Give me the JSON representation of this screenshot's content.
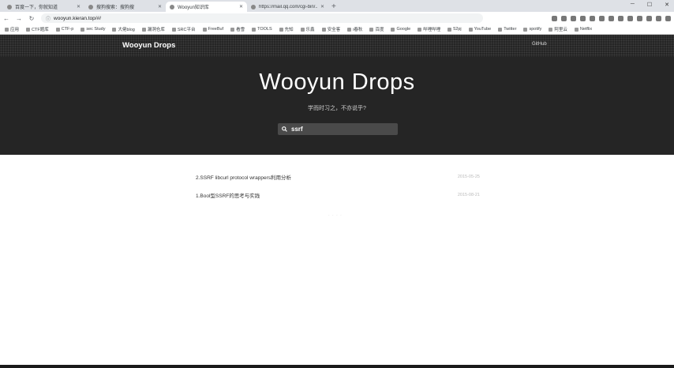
{
  "browser": {
    "tabs": [
      {
        "title": "百度一下，你就知道",
        "active": false
      },
      {
        "title": "搜狗搜索：搜狗搜",
        "active": false
      },
      {
        "title": "Wooyun知识库",
        "active": true
      },
      {
        "title": "https://mail.qq.com/cgi-bin/...",
        "active": false
      }
    ],
    "new_tab": "+",
    "address": "wooyun.kieran.top/#/",
    "bookmarks": [
      "应用",
      "CTF题库",
      "CTF-p",
      "sec Study",
      "大佬blog",
      "漏洞仓库",
      "SRC平台",
      "FreeBuf",
      "看雪",
      "TOOLS",
      "先知",
      "乐鑫",
      "安全客",
      "i春秋",
      "百度",
      "Google",
      "哔哩哔哩",
      "52pj",
      "YouTube",
      "Twitter",
      "spotify",
      "阿里云",
      "Netflix"
    ]
  },
  "site": {
    "brand": "Wooyun Drops",
    "github": "GitHub",
    "title": "Wooyun Drops",
    "subtitle": "学而时习之，不亦说乎?",
    "search_value": "ssrf"
  },
  "results": [
    {
      "title": "2.SSRF libcurl protocol wrappers利用分析",
      "date": "2015-05-25"
    },
    {
      "title": "1.Bool型SSRF的思考与实践",
      "date": "2015-08-21"
    }
  ],
  "loading": "· · · ·"
}
